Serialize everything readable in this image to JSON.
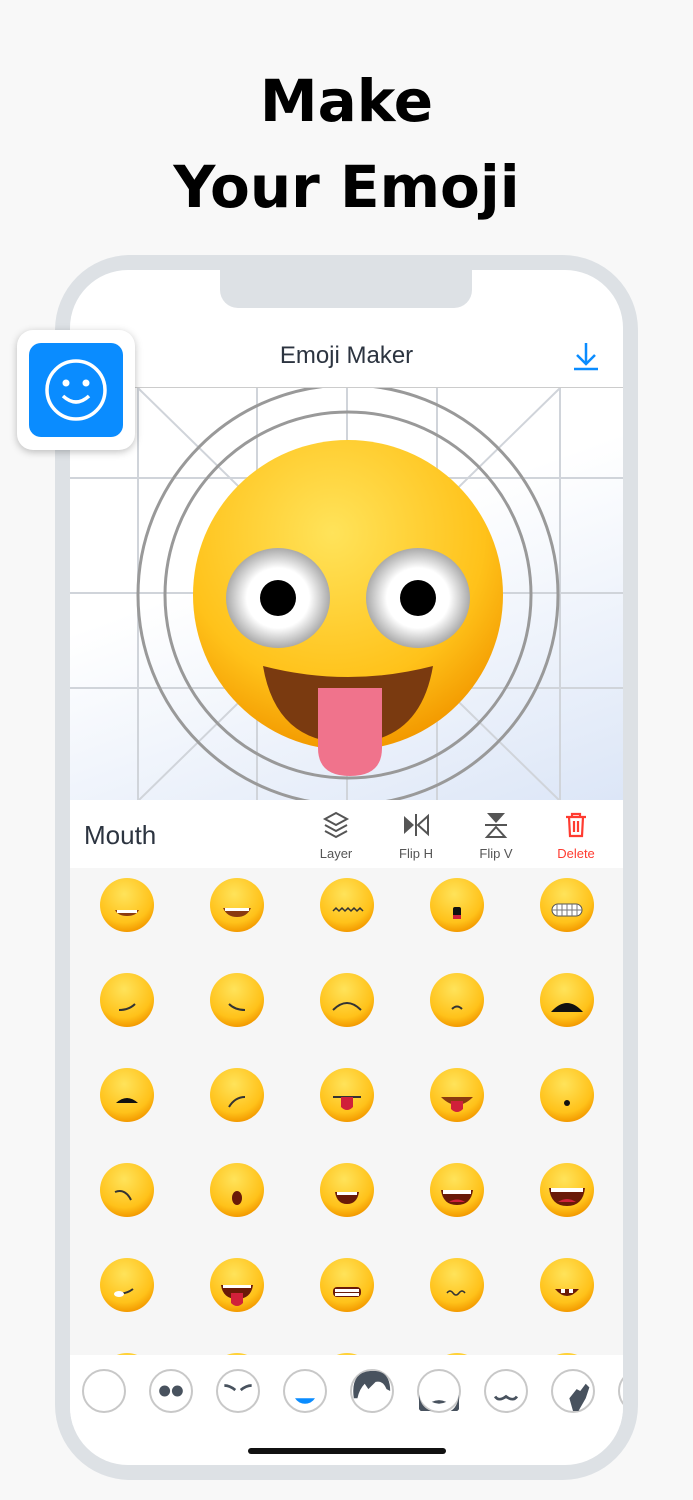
{
  "headline": {
    "line1": "Make",
    "line2": "Your Emoji"
  },
  "app": {
    "title": "Emoji Maker",
    "download_icon": "download-icon"
  },
  "toolbar": {
    "section": "Mouth",
    "tools": [
      {
        "label": "Layer",
        "icon": "layers-icon"
      },
      {
        "label": "Flip H",
        "icon": "flip-horizontal-icon"
      },
      {
        "label": "Flip V",
        "icon": "flip-vertical-icon"
      },
      {
        "label": "Delete",
        "icon": "trash-icon"
      }
    ]
  },
  "colors": {
    "accent": "#0a8cff",
    "delete": "#ff3b30",
    "dark": "#2c3440"
  },
  "mouth_options": [
    "smile-teeth",
    "grin-teeth",
    "wavy",
    "open-small",
    "grimace",
    "smirk-left",
    "smirk-right",
    "frown",
    "small-frown",
    "flat-open",
    "flat-open-small",
    "smirk-up",
    "tongue",
    "tongue-wide",
    "o-small",
    "frown-side",
    "open-o",
    "open-smile",
    "big-grin",
    "laugh",
    "side-tongue",
    "tongue-laugh",
    "teeth-flat",
    "wavy-small",
    "smile-tooth"
  ],
  "parts": [
    "face",
    "eyes",
    "eyebrows",
    "mouth",
    "hair",
    "beard",
    "mustache",
    "hand",
    "more"
  ],
  "selected_part": "mouth"
}
